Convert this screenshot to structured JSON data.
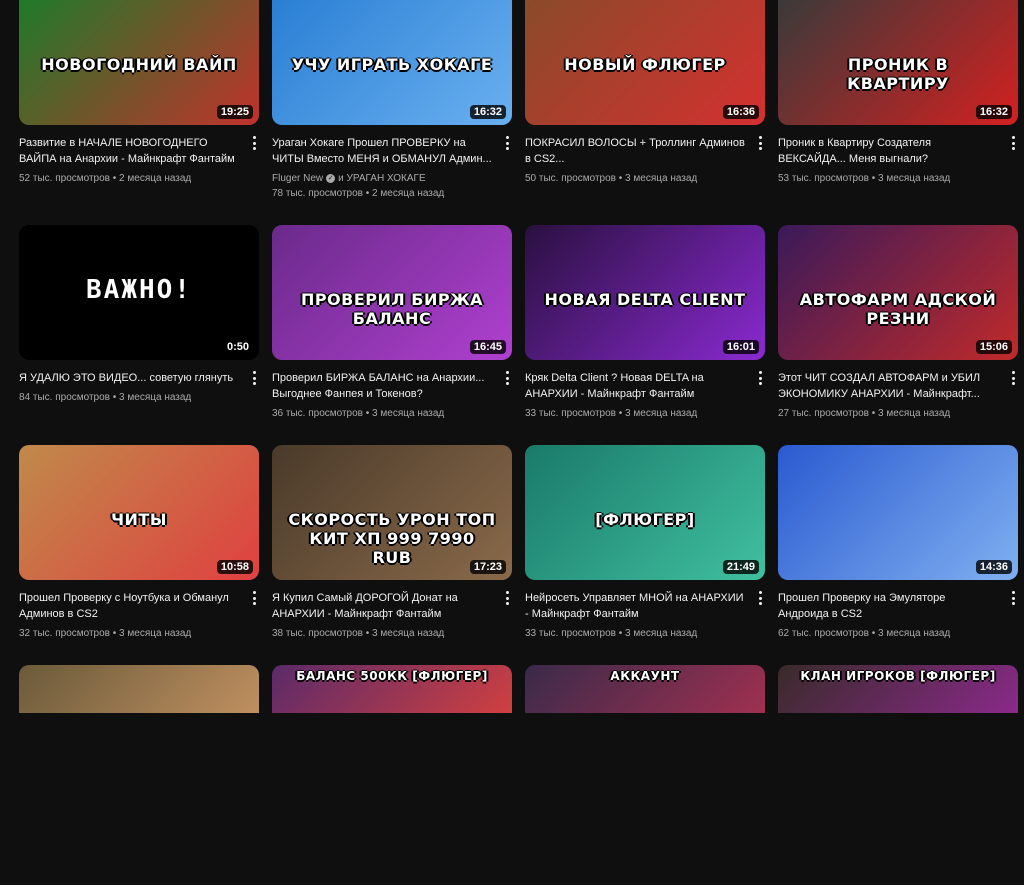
{
  "videos": [
    {
      "title": "Развитие в НАЧАЛЕ НОВОГОДНЕГО ВАЙПА на Анархии - Майнкрафт Фантайм",
      "channel": "",
      "stats": "52 тыс. просмотров • 2 месяца назад",
      "duration": "19:25",
      "overlay": "НОВОГОДНИЙ ВАЙП",
      "colors": [
        "#1f7a2a",
        "#c0322b"
      ]
    },
    {
      "title": "Ураган Хокаге Прошел ПРОВЕРКУ на ЧИТЫ Вместо МЕНЯ и ОБМАНУЛ Админ...",
      "channel": "Fluger New",
      "channel_suffix": "и УРАГАН ХОКАГЕ",
      "stats": "78 тыс. просмотров • 2 месяца назад",
      "duration": "16:32",
      "overlay": "УЧУ ИГРАТЬ ХОКАГЕ",
      "colors": [
        "#2a7fd4",
        "#6ab0f0"
      ]
    },
    {
      "title": "ПОКРАСИЛ ВОЛОСЫ + Троллинг Админов в CS2...",
      "channel": "",
      "stats": "50 тыс. просмотров • 3 месяца назад",
      "duration": "16:36",
      "overlay": "НОВЫЙ ФЛЮГЕР",
      "colors": [
        "#8a4a2a",
        "#d43030"
      ]
    },
    {
      "title": "Проник в Квартиру Создателя ВЕКСАЙДА... Меня выгнали?",
      "channel": "",
      "stats": "53 тыс. просмотров • 3 месяца назад",
      "duration": "16:32",
      "overlay": "ПРОНИК В КВАРТИРУ",
      "colors": [
        "#3a3a3a",
        "#d42020"
      ]
    },
    {
      "title": "Я УДАЛЮ ЭТО ВИДЕО... советую глянуть",
      "channel": "",
      "stats": "84 тыс. просмотров • 3 месяца назад",
      "duration": "0:50",
      "overlay": "ВАЖНО!",
      "colors": [
        "#000000",
        "#000000"
      ]
    },
    {
      "title": "Проверил БИРЖА БАЛАНС на Анархии... Выгоднее Фанпея и Токенов?",
      "channel": "",
      "stats": "36 тыс. просмотров • 3 месяца назад",
      "duration": "16:45",
      "overlay": "ПРОВЕРИЛ БИРЖА БАЛАНС",
      "colors": [
        "#6a2a8a",
        "#b040d0"
      ]
    },
    {
      "title": "Кряк Delta Client ? Новая DELTA на АНАРХИИ - Майнкрафт Фантайм",
      "channel": "",
      "stats": "33 тыс. просмотров • 3 месяца назад",
      "duration": "16:01",
      "overlay": "НОВАЯ DELTA CLIENT",
      "colors": [
        "#2a1040",
        "#8a2ad0"
      ]
    },
    {
      "title": "Этот ЧИТ СОЗДАЛ АВТОФАРМ и УБИЛ ЭКОНОМИКУ АНАРХИИ - Майнкрафт...",
      "channel": "",
      "stats": "27 тыс. просмотров • 3 месяца назад",
      "duration": "15:06",
      "overlay": "АВТОФАРМ АДСКОЙ РЕЗНИ",
      "colors": [
        "#3a1a5a",
        "#c02a2a"
      ]
    },
    {
      "title": "Прошел Проверку с Ноутбука и Обманул Админов в CS2",
      "channel": "",
      "stats": "32 тыс. просмотров • 3 месяца назад",
      "duration": "10:58",
      "overlay": "ЧИТЫ",
      "colors": [
        "#c08a4a",
        "#e04040"
      ]
    },
    {
      "title": "Я Купил Самый ДОРОГОЙ Донат на АНАРХИИ - Майнкрафт Фантайм",
      "channel": "",
      "stats": "38 тыс. просмотров • 3 месяца назад",
      "duration": "17:23",
      "overlay": "СКОРОСТЬ УРОН ТОП КИТ ХП 999 7990 RUB",
      "colors": [
        "#4a3a2a",
        "#8a6a4a"
      ]
    },
    {
      "title": "Нейросеть Управляет МНОЙ на АНАРХИИ - Майнкрафт Фантайм",
      "channel": "",
      "stats": "33 тыс. просмотров • 3 месяца назад",
      "duration": "21:49",
      "overlay": "[ФЛЮГЕР]",
      "colors": [
        "#1a7a6a",
        "#40c0a0"
      ]
    },
    {
      "title": "Прошел Проверку на Эмуляторе Андроида в CS2",
      "channel": "",
      "stats": "62 тыс. просмотров • 3 месяца назад",
      "duration": "14:36",
      "overlay": "",
      "colors": [
        "#2a5ad0",
        "#80b0f0"
      ]
    },
    {
      "title": "",
      "channel": "",
      "stats": "",
      "duration": "",
      "overlay": "",
      "colors": [
        "#6a5a3a",
        "#c09060"
      ]
    },
    {
      "title": "",
      "channel": "",
      "stats": "",
      "duration": "",
      "overlay": "БАЛАНС 500КК [ФЛЮГЕР]",
      "colors": [
        "#5a2a6a",
        "#d04040"
      ]
    },
    {
      "title": "",
      "channel": "",
      "stats": "",
      "duration": "",
      "overlay": "АККАУНТ",
      "colors": [
        "#3a2a4a",
        "#a03050"
      ]
    },
    {
      "title": "",
      "channel": "",
      "stats": "",
      "duration": "",
      "overlay": "КЛАН ИГРОКОВ [ФЛЮГЕР]",
      "colors": [
        "#3a2a2a",
        "#8a2a8a"
      ]
    }
  ]
}
